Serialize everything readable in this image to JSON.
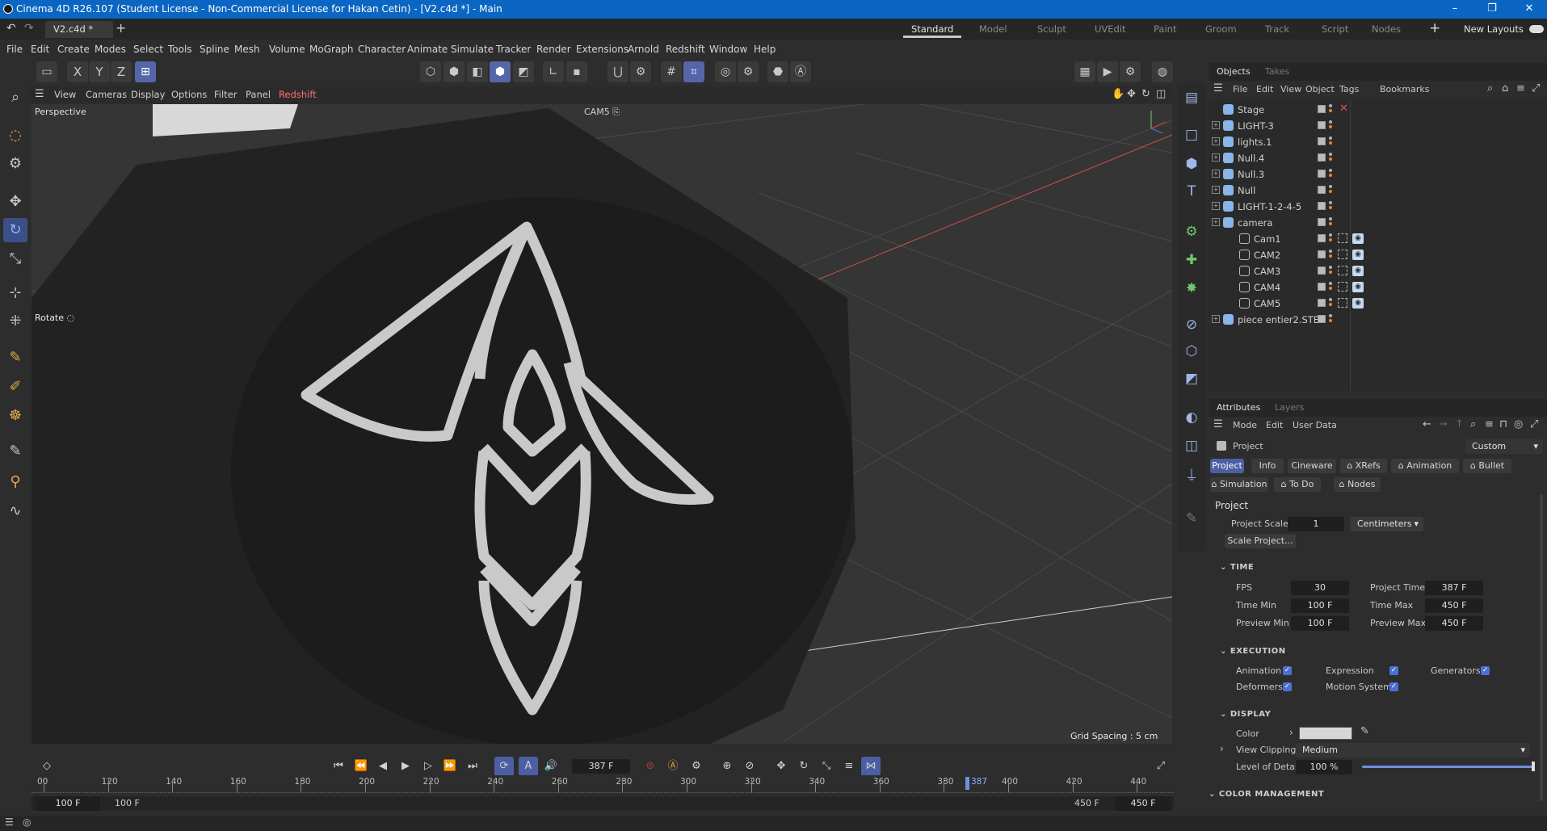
{
  "window": {
    "title": "Cinema 4D R26.107 (Student License - Non-Commercial License for Hakan Cetin) - [V2.c4d *] - Main",
    "doc_tab": "V2.c4d *"
  },
  "layouts": [
    "Standard",
    "Model",
    "Sculpt",
    "UVEdit",
    "Paint",
    "Groom",
    "Track",
    "Script",
    "Nodes"
  ],
  "layouts_active": "Standard",
  "new_layouts": "New Layouts",
  "menubar": [
    "File",
    "Edit",
    "Create",
    "Modes",
    "Select",
    "Tools",
    "Spline",
    "Mesh",
    "Volume",
    "MoGraph",
    "Character",
    "Animate",
    "Simulate",
    "Tracker",
    "Render",
    "Extensions",
    "Arnold",
    "Redshift",
    "Window",
    "Help"
  ],
  "axis_buttons": {
    "x": "X",
    "y": "Y",
    "z": "Z"
  },
  "viewport_menu": [
    "View",
    "Cameras",
    "Display",
    "Options",
    "Filter",
    "Panel",
    "Redshift"
  ],
  "viewport": {
    "label": "Perspective",
    "camera": "CAM5",
    "tool_label": "Rotate",
    "grid_spacing": "Grid Spacing : 5 cm"
  },
  "objects_panel": {
    "tabs": [
      "Objects",
      "Takes"
    ],
    "menu": [
      "File",
      "Edit",
      "View",
      "Object",
      "Tags",
      "Bookmarks"
    ],
    "items": [
      {
        "name": "Stage",
        "indent": 0,
        "expander": false,
        "tag": "x"
      },
      {
        "name": "LIGHT-3",
        "indent": 0,
        "expander": true,
        "tag": ""
      },
      {
        "name": "lights.1",
        "indent": 0,
        "expander": true,
        "tag": ""
      },
      {
        "name": "Null.4",
        "indent": 0,
        "expander": true,
        "tag": ""
      },
      {
        "name": "Null.3",
        "indent": 0,
        "expander": true,
        "tag": ""
      },
      {
        "name": "Null",
        "indent": 0,
        "expander": true,
        "tag": ""
      },
      {
        "name": "LIGHT-1-2-4-5",
        "indent": 0,
        "expander": true,
        "tag": ""
      },
      {
        "name": "camera",
        "indent": 0,
        "expander": true,
        "tag": ""
      },
      {
        "name": "Cam1",
        "indent": 1,
        "expander": false,
        "tag": "cam"
      },
      {
        "name": "CAM2",
        "indent": 1,
        "expander": false,
        "tag": "cam"
      },
      {
        "name": "CAM3",
        "indent": 1,
        "expander": false,
        "tag": "cam"
      },
      {
        "name": "CAM4",
        "indent": 1,
        "expander": false,
        "tag": "cam"
      },
      {
        "name": "CAM5",
        "indent": 1,
        "expander": false,
        "tag": "cam"
      },
      {
        "name": "piece entier2.STEP",
        "indent": 0,
        "expander": true,
        "tag": ""
      }
    ]
  },
  "attributes_panel": {
    "tabs": [
      "Attributes",
      "Layers"
    ],
    "menu": [
      "Mode",
      "Edit",
      "User Data"
    ],
    "object": "Project",
    "preset": "Custom",
    "buttons_row1": [
      "Project",
      "Info",
      "Cineware",
      "XRefs",
      "Animation",
      "Bullet"
    ],
    "buttons_row2": [
      "Simulation",
      "To Do",
      "Nodes"
    ],
    "section_title": "Project",
    "project_scale_label": "Project Scale",
    "project_scale_value": "1",
    "project_scale_unit": "Centimeters",
    "scale_project_button": "Scale Project...",
    "time": {
      "header": "TIME",
      "fps_label": "FPS",
      "fps": "30",
      "project_time_label": "Project Time",
      "project_time": "387 F",
      "time_min_label": "Time Min",
      "time_min": "100 F",
      "time_max_label": "Time Max",
      "time_max": "450 F",
      "preview_min_label": "Preview Min",
      "preview_min": "100 F",
      "preview_max_label": "Preview Max",
      "preview_max": "450 F"
    },
    "execution": {
      "header": "EXECUTION",
      "items": [
        "Animation",
        "Expression",
        "Generators",
        "Deformers",
        "Motion System"
      ]
    },
    "display": {
      "header": "DISPLAY",
      "color_label": "Color",
      "color_value": "#d6d6d6",
      "view_clipping_label": "View Clipping",
      "view_clipping": "Medium",
      "lod_label": "Level of Detail",
      "lod": "100 %"
    },
    "color_management_header": "COLOR MANAGEMENT"
  },
  "timeline": {
    "current_frame": "387 F",
    "ruler_ticks": [
      "00",
      "120",
      "140",
      "160",
      "180",
      "200",
      "220",
      "240",
      "260",
      "280",
      "300",
      "320",
      "340",
      "360",
      "380",
      "400",
      "420",
      "440"
    ],
    "playhead_label": "387",
    "min_left": "100 F",
    "min_right": "100 F",
    "max_left": "450 F",
    "max_right": "450 F"
  },
  "colors": {
    "accent": "#4c5fa3",
    "titlebar": "#0a66c2",
    "logo_stroke": "#c9c9c9"
  }
}
